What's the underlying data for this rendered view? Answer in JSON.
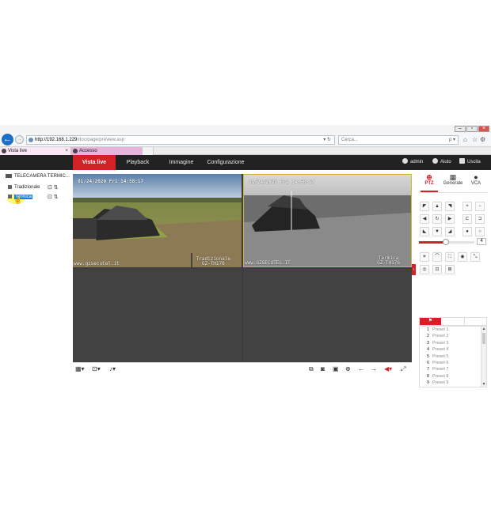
{
  "browser": {
    "url_host": "http://192.168.1.229",
    "url_rest": "/doc/page/preview.asp",
    "url_tools": "▾ ↻",
    "search_placeholder": "Cerca...",
    "search_tools": "ρ ▾",
    "tabs": [
      {
        "label": "Vista live",
        "close": "×"
      },
      {
        "label": "Accesso"
      }
    ],
    "toolbar_icons": [
      "home-icon",
      "star-icon",
      "gear-icon",
      "smiley-icon"
    ],
    "window_controls": [
      "–",
      "▫",
      "×"
    ]
  },
  "app": {
    "nav": {
      "live": "Vista live",
      "playback": "Playback",
      "immagine": "Immagine",
      "config": "Configurazione"
    },
    "header": {
      "user": "admin",
      "help": "Aiuto",
      "exit": "Uscita"
    },
    "colors": {
      "accent": "#d42027",
      "nav_bg": "#222222",
      "selection": "#1f7fd8"
    }
  },
  "tree": {
    "root": "TELECAMERA TERMIC...",
    "items": [
      {
        "label": "Tradizionale",
        "actions": "⊡ ⇅"
      },
      {
        "label": "Termica",
        "actions": "⊡ ⇅"
      }
    ]
  },
  "video": {
    "cells": [
      {
        "timestamp": "01/24/2020 Fri 14:58:17",
        "watermark": "www.gzsecutel.it",
        "name_line1": "Tradizionale",
        "name_line2": "GZ-TH176"
      },
      {
        "timestamp": "01/24/2020 Fri 14:58:17",
        "watermark": "www.GZSECUTEL.IT",
        "name_line1": "Termica",
        "name_line2": "GZ-TH176"
      },
      {},
      {}
    ]
  },
  "video_toolbar": {
    "left": [
      "layout-icon",
      "stream-icon",
      "audio-icon"
    ],
    "right": [
      "capture-icon",
      "snapshot-icon",
      "record-icon",
      "zoom-icon",
      "prev-page-icon",
      "next-page-icon",
      "volume-icon",
      "fullscreen-icon"
    ]
  },
  "ptz": {
    "tabs": {
      "ptz": "PTZ",
      "generale": "Generale",
      "vca": "VCA"
    },
    "speed": "4",
    "speed_level": 0.48,
    "presets": [
      {
        "num": "1",
        "name": "Preset 1"
      },
      {
        "num": "2",
        "name": "Preset 2"
      },
      {
        "num": "3",
        "name": "Preset 3"
      },
      {
        "num": "4",
        "name": "Preset 4"
      },
      {
        "num": "5",
        "name": "Preset 5"
      },
      {
        "num": "6",
        "name": "Preset 6"
      },
      {
        "num": "7",
        "name": "Preset 7"
      },
      {
        "num": "8",
        "name": "Preset 8"
      },
      {
        "num": "9",
        "name": "Preset 9"
      }
    ]
  }
}
